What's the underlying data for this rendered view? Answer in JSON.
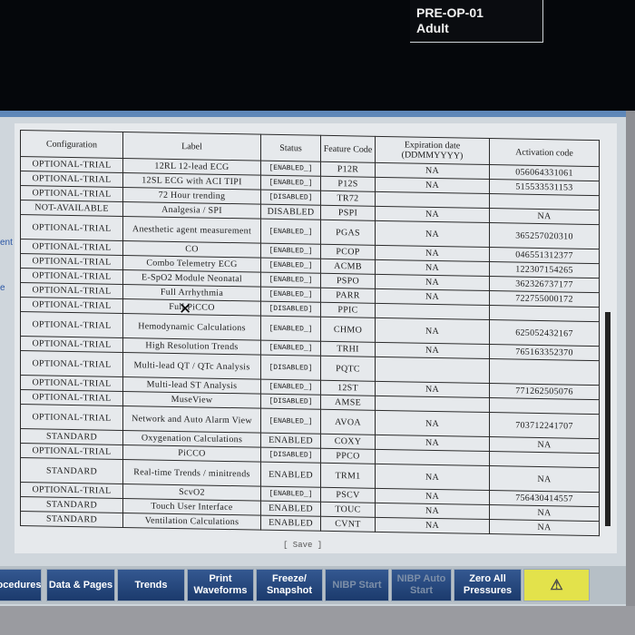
{
  "patient": {
    "line1": "PRE-OP-01",
    "line2": "Adult"
  },
  "left_fragments": [
    "ent",
    "e"
  ],
  "columns": [
    "Configuration",
    "Label",
    "Status",
    "Feature Code",
    "Expiration date (DDMMYYYY)",
    "Activation code"
  ],
  "rows": [
    {
      "config": "OPTIONAL-TRIAL",
      "label": "12RL 12-lead ECG",
      "status": "[ENABLED_]",
      "code": "P12R",
      "exp": "NA",
      "act": "056064331061"
    },
    {
      "config": "OPTIONAL-TRIAL",
      "label": "12SL ECG with ACI TIPI",
      "status": "[ENABLED_]",
      "code": "P12S",
      "exp": "NA",
      "act": "515533531153"
    },
    {
      "config": "OPTIONAL-TRIAL",
      "label": "72 Hour trending",
      "status": "[DISABLED]",
      "code": "TR72",
      "exp": "",
      "act": ""
    },
    {
      "config": "NOT-AVAILABLE",
      "label": "Analgesia / SPI",
      "status": "DISABLED",
      "code": "PSPI",
      "exp": "NA",
      "act": "NA"
    },
    {
      "config": "OPTIONAL-TRIAL",
      "label": "Anesthetic agent measurement",
      "status": "[ENABLED_]",
      "code": "PGAS",
      "exp": "NA",
      "act": "365257020310"
    },
    {
      "config": "OPTIONAL-TRIAL",
      "label": "CO",
      "status": "[ENABLED_]",
      "code": "PCOP",
      "exp": "NA",
      "act": "046551312377"
    },
    {
      "config": "OPTIONAL-TRIAL",
      "label": "Combo Telemetry ECG",
      "status": "[ENABLED_]",
      "code": "ACMB",
      "exp": "NA",
      "act": "122307154265"
    },
    {
      "config": "OPTIONAL-TRIAL",
      "label": "E-SpO2 Module Neonatal",
      "status": "[ENABLED_]",
      "code": "PSPO",
      "exp": "NA",
      "act": "362326737177"
    },
    {
      "config": "OPTIONAL-TRIAL",
      "label": "Full Arrhythmia",
      "status": "[ENABLED_]",
      "code": "PARR",
      "exp": "NA",
      "act": "722755000172"
    },
    {
      "config": "OPTIONAL-TRIAL",
      "label": "Full PiCCO",
      "status": "[DISABLED]",
      "code": "PPIC",
      "exp": "",
      "act": ""
    },
    {
      "config": "OPTIONAL-TRIAL",
      "label": "Hemodynamic Calculations",
      "status": "[ENABLED_]",
      "code": "CHMO",
      "exp": "NA",
      "act": "625052432167"
    },
    {
      "config": "OPTIONAL-TRIAL",
      "label": "High Resolution Trends",
      "status": "[ENABLED_]",
      "code": "TRHI",
      "exp": "NA",
      "act": "765163352370"
    },
    {
      "config": "OPTIONAL-TRIAL",
      "label": "Multi-lead QT / QTc Analysis",
      "status": "[DISABLED]",
      "code": "PQTC",
      "exp": "",
      "act": ""
    },
    {
      "config": "OPTIONAL-TRIAL",
      "label": "Multi-lead ST Analysis",
      "status": "[ENABLED_]",
      "code": "12ST",
      "exp": "NA",
      "act": "771262505076"
    },
    {
      "config": "OPTIONAL-TRIAL",
      "label": "MuseView",
      "status": "[DISABLED]",
      "code": "AMSE",
      "exp": "",
      "act": ""
    },
    {
      "config": "OPTIONAL-TRIAL",
      "label": "Network and Auto Alarm View",
      "status": "[ENABLED_]",
      "code": "AVOA",
      "exp": "NA",
      "act": "703712241707"
    },
    {
      "config": "STANDARD",
      "label": "Oxygenation Calculations",
      "status": "ENABLED",
      "code": "COXY",
      "exp": "NA",
      "act": "NA"
    },
    {
      "config": "OPTIONAL-TRIAL",
      "label": "PiCCO",
      "status": "[DISABLED]",
      "code": "PPCO",
      "exp": "",
      "act": ""
    },
    {
      "config": "STANDARD",
      "label": "Real-time Trends / minitrends",
      "status": "ENABLED",
      "code": "TRM1",
      "exp": "NA",
      "act": "NA"
    },
    {
      "config": "OPTIONAL-TRIAL",
      "label": "ScvO2",
      "status": "[ENABLED_]",
      "code": "PSCV",
      "exp": "NA",
      "act": "756430414557"
    },
    {
      "config": "STANDARD",
      "label": "Touch User Interface",
      "status": "ENABLED",
      "code": "TOUC",
      "exp": "NA",
      "act": "NA"
    },
    {
      "config": "STANDARD",
      "label": "Ventilation Calculations",
      "status": "ENABLED",
      "code": "CVNT",
      "exp": "NA",
      "act": "NA"
    }
  ],
  "save_label": "[ Save ]",
  "buttons": [
    {
      "label": "ocedures",
      "state": "enabled"
    },
    {
      "label": "Data & Pages",
      "state": "enabled"
    },
    {
      "label": "Trends",
      "state": "enabled"
    },
    {
      "label": "Print Waveforms",
      "state": "enabled"
    },
    {
      "label": "Freeze/ Snapshot",
      "state": "enabled"
    },
    {
      "label": "NIBP Start",
      "state": "disabled"
    },
    {
      "label": "NIBP Auto Start",
      "state": "disabled"
    },
    {
      "label": "Zero All Pressures",
      "state": "enabled"
    },
    {
      "label": "alarm-silence-icon",
      "state": "enabled"
    }
  ]
}
